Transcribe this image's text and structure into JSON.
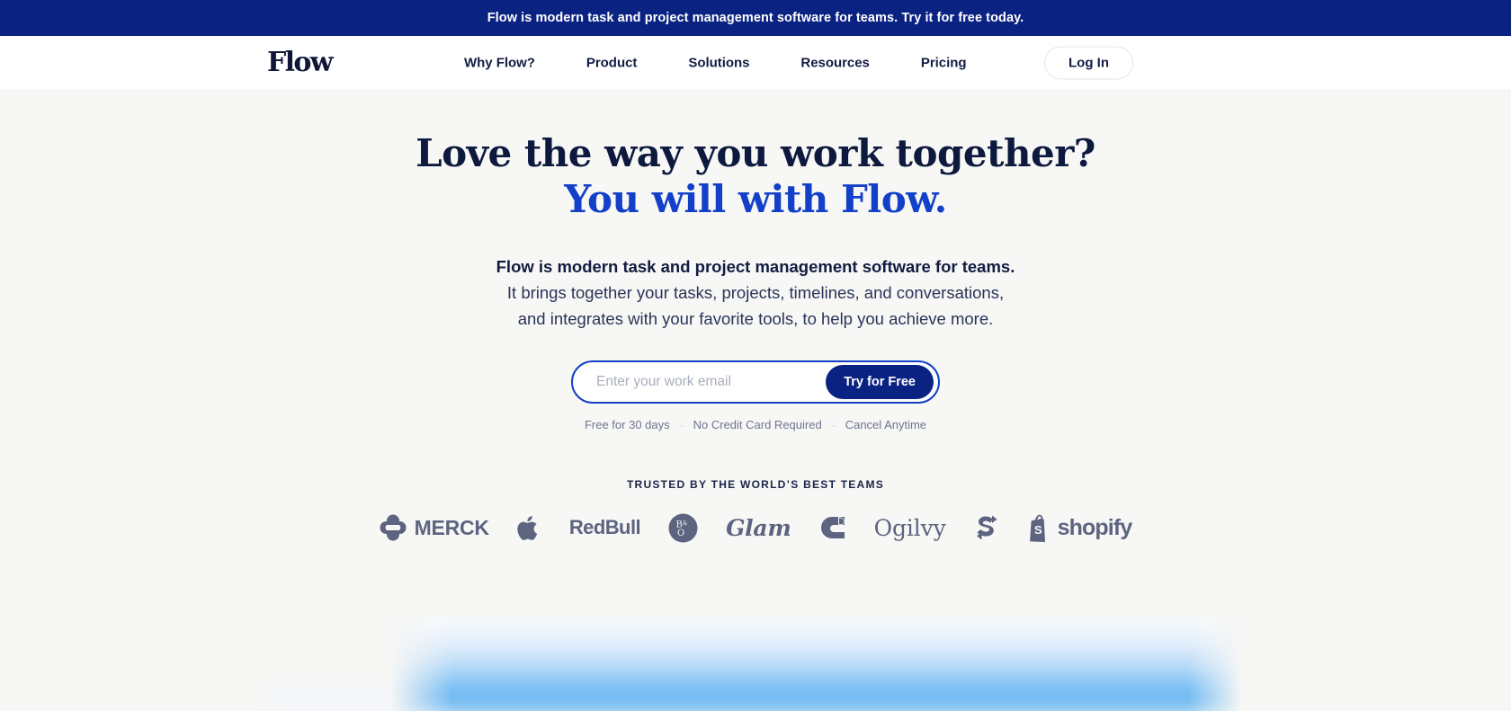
{
  "announcement": {
    "text": "Flow is modern task and project management software for teams. Try it for free today."
  },
  "nav": {
    "logo": "Flow",
    "links": [
      {
        "label": "Why Flow?"
      },
      {
        "label": "Product"
      },
      {
        "label": "Solutions"
      },
      {
        "label": "Resources"
      },
      {
        "label": "Pricing"
      }
    ],
    "login_label": "Log In"
  },
  "hero": {
    "headline_line1": "Love the way you work together?",
    "headline_line2": "You will with Flow.",
    "sub_line1": "Flow is modern task and project management software for teams.",
    "sub_line2": "It brings together your tasks, projects, timelines, and conversations,",
    "sub_line3": "and integrates with your favorite tools, to help you achieve more.",
    "email_placeholder": "Enter your work email",
    "email_value": "",
    "cta_label": "Try for Free",
    "fineprint": [
      {
        "text": "Free for 30 days"
      },
      {
        "text": "No Credit Card Required"
      },
      {
        "text": "Cancel Anytime"
      }
    ],
    "fineprint_separator": "·"
  },
  "trusted": {
    "label": "TRUSTED BY THE WORLD’S BEST TEAMS",
    "brands": [
      {
        "name": "Merck",
        "text": "MERCK",
        "icon": "merck-icon"
      },
      {
        "name": "Apple",
        "text": "",
        "icon": "apple-icon"
      },
      {
        "name": "Red Bull",
        "text": "RedBull",
        "icon": ""
      },
      {
        "name": "Bang & Olufsen",
        "text": "",
        "icon": "bang-olufsen-icon"
      },
      {
        "name": "Glam",
        "text": "Glam",
        "icon": ""
      },
      {
        "name": "Carhartt",
        "text": "",
        "icon": "carhartt-icon"
      },
      {
        "name": "Ogilvy",
        "text": "Ogilvy",
        "icon": ""
      },
      {
        "name": "Sage",
        "text": "",
        "icon": "sage-s-icon"
      },
      {
        "name": "Shopify",
        "text": "shopify",
        "icon": "shopify-bag-icon"
      }
    ]
  },
  "colors": {
    "banner_blue": "#0a2282",
    "accent_blue": "#1340c8",
    "navy_text": "#0d1a3e",
    "page_background": "#f7f7f5",
    "logo_gray": "#5d6480"
  }
}
